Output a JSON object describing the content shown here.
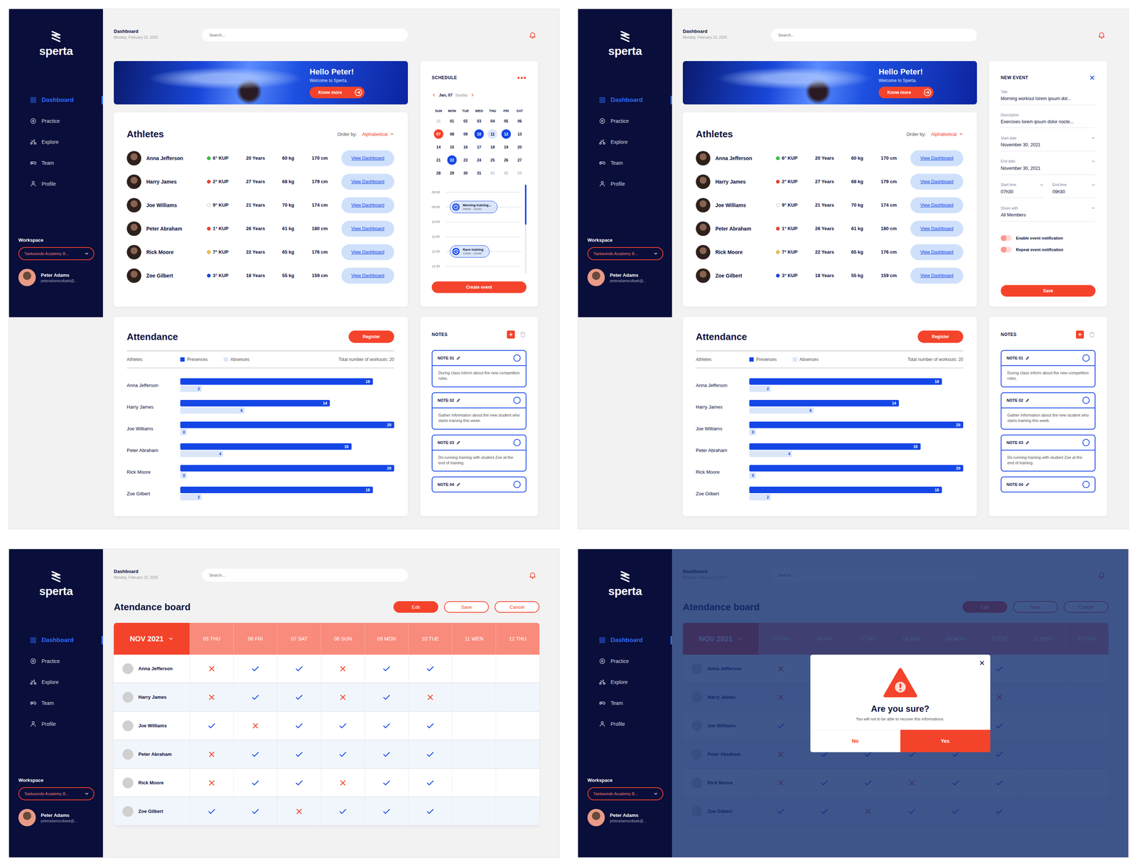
{
  "app": {
    "logo": "sperta"
  },
  "sidebar": {
    "items": [
      {
        "label": "Dashboard",
        "selected": true
      },
      {
        "label": "Practice",
        "selected": false
      },
      {
        "label": "Explore",
        "selected": false
      },
      {
        "label": "Team",
        "selected": false
      },
      {
        "label": "Profile",
        "selected": false
      }
    ],
    "workspace": {
      "label": "Workspace",
      "value": "Taekwondo Academy B..."
    },
    "user": {
      "name": "Peter Adams",
      "email": "peteradamscdtaek@..."
    }
  },
  "header": {
    "title": "Dashboard",
    "date": "Monday, February 22, 2020",
    "search": {
      "placeholder": "Search..."
    }
  },
  "hero": {
    "title": "Hello Peter!",
    "subtitle": "Welcome to Sperta.",
    "button": "Know more"
  },
  "athletes": {
    "title": "Athletes",
    "order_label": "Order by:",
    "order_value": "Alphabetical",
    "rows": [
      {
        "name": "Anna Jefferson",
        "rank": "6° KUP",
        "color": "#2ecc40",
        "age": "20 Years",
        "weight": "60 kg",
        "height": "170 cm",
        "link": "View Dashboard"
      },
      {
        "name": "Harry James",
        "rank": "2° KUP",
        "color": "#f4432b",
        "age": "27 Years",
        "weight": "68 kg",
        "height": "179 cm",
        "link": "View Dashboard"
      },
      {
        "name": "Joe Williams",
        "rank": "9° KUP",
        "color": "#ffffff",
        "age": "21 Years",
        "weight": "70 kg",
        "height": "174 cm",
        "link": "View Dashboard"
      },
      {
        "name": "Peter Abraham",
        "rank": "1° KUP",
        "color": "#f4432b",
        "age": "26 Years",
        "weight": "61 kg",
        "height": "180 cm",
        "link": "View Dashboard"
      },
      {
        "name": "Rick Moore",
        "rank": "7° KUP",
        "color": "#f6c343",
        "age": "22 Years",
        "weight": "65 kg",
        "height": "176 cm",
        "link": "View Dashboard"
      },
      {
        "name": "Zoe Gilbert",
        "rank": "3° KUP",
        "color": "#1447e6",
        "age": "18 Years",
        "weight": "55 kg",
        "height": "159 cm",
        "link": "View Dashboard"
      }
    ]
  },
  "schedule": {
    "title": "SCHEDULE",
    "month": "Jan, 07",
    "weekday": "Sunday",
    "days": [
      "SUN",
      "MON",
      "TUE",
      "WED",
      "THU",
      "FRI",
      "SAT"
    ],
    "weeks": [
      [
        {
          "label": "31",
          "muted": true,
          "marked": false
        },
        {
          "label": "01",
          "muted": false,
          "marked": false
        },
        {
          "label": "02",
          "muted": false,
          "marked": false
        },
        {
          "label": "03",
          "muted": false,
          "marked": false
        },
        {
          "label": "04",
          "muted": false,
          "marked": false
        },
        {
          "label": "05",
          "muted": false,
          "marked": false
        },
        {
          "label": "06",
          "muted": false,
          "marked": false
        }
      ],
      [
        {
          "label": "07",
          "muted": false,
          "marked": true,
          "color": "#f4432b"
        },
        {
          "label": "08",
          "muted": false,
          "marked": false
        },
        {
          "label": "09",
          "muted": false,
          "marked": false
        },
        {
          "label": "10",
          "muted": false,
          "marked": true,
          "color": "#1447e6"
        },
        {
          "label": "11",
          "muted": false,
          "marked": true,
          "color": "#dbe6fb"
        },
        {
          "label": "12",
          "muted": false,
          "marked": true,
          "color": "#1447e6"
        },
        {
          "label": "13",
          "muted": false,
          "marked": false
        }
      ],
      [
        {
          "label": "14",
          "muted": false,
          "marked": false
        },
        {
          "label": "15",
          "muted": false,
          "marked": false
        },
        {
          "label": "16",
          "muted": false,
          "marked": false
        },
        {
          "label": "17",
          "muted": false,
          "marked": false
        },
        {
          "label": "18",
          "muted": false,
          "marked": false
        },
        {
          "label": "19",
          "muted": false,
          "marked": false
        },
        {
          "label": "20",
          "muted": false,
          "marked": false
        }
      ],
      [
        {
          "label": "21",
          "muted": false,
          "marked": false
        },
        {
          "label": "22",
          "muted": false,
          "marked": true,
          "color": "#1447e6"
        },
        {
          "label": "23",
          "muted": false,
          "marked": false
        },
        {
          "label": "24",
          "muted": false,
          "marked": false
        },
        {
          "label": "25",
          "muted": false,
          "marked": false
        },
        {
          "label": "26",
          "muted": false,
          "marked": false
        },
        {
          "label": "27",
          "muted": false,
          "marked": false
        }
      ],
      [
        {
          "label": "28",
          "muted": false,
          "marked": false
        },
        {
          "label": "29",
          "muted": false,
          "marked": false
        },
        {
          "label": "30",
          "muted": false,
          "marked": false
        },
        {
          "label": "31",
          "muted": false,
          "marked": false
        },
        {
          "label": "01",
          "muted": true,
          "marked": false
        },
        {
          "label": "02",
          "muted": true,
          "marked": false
        },
        {
          "label": "03",
          "muted": true,
          "marked": false
        }
      ]
    ],
    "slots": [
      {
        "time": "08:00"
      },
      {
        "time": "09:00",
        "event": {
          "title": "Morning training...",
          "time": "09h00 - 10h30"
        }
      },
      {
        "time": "10:00"
      },
      {
        "time": "11:00"
      },
      {
        "time": "12:00",
        "event": {
          "title": "Race training",
          "time": "12h00 - 12h45"
        }
      },
      {
        "time": "13:30"
      }
    ],
    "scroll_level": 0.45,
    "button": "Create event"
  },
  "new_event": {
    "title": "NEW EVENT",
    "rows": [
      [
        {
          "label": "Title",
          "value": "Morning workout lorem ipsum dol...",
          "kind": "text"
        }
      ],
      [
        {
          "label": "Description",
          "value": "Exercises lorem ipsum dolor nocte...",
          "kind": "text"
        }
      ],
      [
        {
          "label": "Start date",
          "value": "November 30, 2021",
          "kind": "select"
        }
      ],
      [
        {
          "label": "End date",
          "value": "November 30, 2021",
          "kind": "select"
        }
      ],
      [
        {
          "label": "Start time",
          "value": "07h30",
          "kind": "select"
        },
        {
          "label": "End time",
          "value": "09h30",
          "kind": "select"
        }
      ],
      [
        {
          "label": "Share with",
          "value": "All Members",
          "kind": "select"
        }
      ]
    ],
    "toggles": [
      {
        "label": "Enable event notification",
        "on": false
      },
      {
        "label": "Repeat event notification",
        "on": false
      }
    ],
    "button": "Save"
  },
  "attendance": {
    "title": "Attendance",
    "button": "Register",
    "column": "Athletes",
    "legend": [
      {
        "label": "Presences",
        "color": "#1447e6"
      },
      {
        "label": "Absences",
        "color": "#dbe6fb"
      }
    ],
    "total": "Total number of workouts: 20",
    "max": 20,
    "rows": [
      {
        "name": "Anna Jefferson",
        "presences": 18,
        "absences": 2,
        "presences_text": "18",
        "absences_text": "2"
      },
      {
        "name": "Harry James",
        "presences": 14,
        "absences": 6,
        "presences_text": "14",
        "absences_text": "6"
      },
      {
        "name": "Joe Williams",
        "presences": 20,
        "absences": 0,
        "presences_text": "20",
        "absences_text": "0"
      },
      {
        "name": "Peter Abraham",
        "presences": 16,
        "absences": 4,
        "presences_text": "16",
        "absences_text": "4"
      },
      {
        "name": "Rick Moore",
        "presences": 20,
        "absences": 0,
        "presences_text": "20",
        "absences_text": "0"
      },
      {
        "name": "Zoe Gilbert",
        "presences": 18,
        "absences": 2,
        "presences_text": "18",
        "absences_text": "2"
      }
    ]
  },
  "notes": {
    "title": "NOTES",
    "items": [
      {
        "title": "NOTE 01",
        "done": false,
        "text": "During class inform about the new competition rules."
      },
      {
        "title": "NOTE 02",
        "done": false,
        "text": "Gather information about the new student who starts training this week."
      },
      {
        "title": "NOTE 03",
        "done": false,
        "text": "Do running training with student Zoe at the end of training."
      },
      {
        "title": "NOTE 04",
        "done": false
      }
    ]
  },
  "board": {
    "title": "Atendance board",
    "actions": [
      {
        "label": "Edit",
        "kind": "filled"
      },
      {
        "label": "Save",
        "kind": "outline"
      },
      {
        "label": "Cancel",
        "kind": "outline"
      }
    ],
    "month": "NOV 2021",
    "columns": [
      "05 THU",
      "06 FRI",
      "07 SAT",
      "08 SUN",
      "09 MON",
      "10 TUE",
      "11 WEN",
      "12 THU"
    ],
    "rows": [
      {
        "name": "Anna Jefferson",
        "marks": [
          false,
          true,
          true,
          false,
          true,
          true
        ]
      },
      {
        "name": "Harry James",
        "marks": [
          false,
          true,
          true,
          false,
          true,
          false
        ]
      },
      {
        "name": "Joe Williams",
        "marks": [
          true,
          false,
          true,
          true,
          true,
          true
        ]
      },
      {
        "name": "Peter Abraham",
        "marks": [
          false,
          true,
          true,
          true,
          true,
          true
        ]
      },
      {
        "name": "Rick Moore",
        "marks": [
          false,
          true,
          true,
          false,
          true,
          true
        ]
      },
      {
        "name": "Zoe Gilbert",
        "marks": [
          true,
          true,
          false,
          true,
          true,
          true
        ]
      }
    ]
  },
  "dialog": {
    "title": "Are you sure?",
    "message": "You will not to be able to recover this informations.",
    "buttons": [
      {
        "label": "No",
        "kind": "secondary"
      },
      {
        "label": "Yes",
        "kind": "primary"
      }
    ]
  },
  "screens": [
    {
      "kind": "dashboard",
      "side_panel": "schedule",
      "dialog_open": false
    },
    {
      "kind": "dashboard",
      "side_panel": "new-event",
      "dialog_open": false
    },
    {
      "kind": "board",
      "side_panel": "none",
      "dialog_open": false
    },
    {
      "kind": "board",
      "side_panel": "none",
      "dialog_open": true
    }
  ]
}
